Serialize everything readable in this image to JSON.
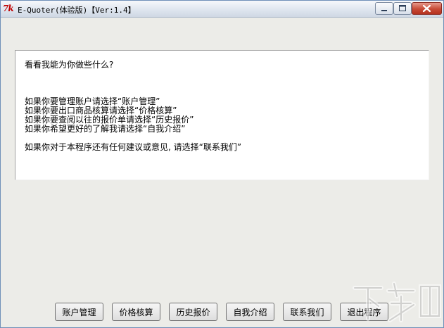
{
  "window": {
    "icon_text": "7k",
    "title": "E-Quoter(体验版)【Ver:1.4】",
    "controls": {
      "minimize": "minimize-icon",
      "maximize": "maximize-icon",
      "close": "close-icon"
    }
  },
  "main": {
    "greeting": "看看我能为你做些什么?",
    "lines": [
      "如果你要管理账户请选择“账户管理”",
      "如果你要出口商品核算请选择“价格核算”",
      "如果你要查阅以往的报价单请选择“历史报价”",
      "如果你希望更好的了解我请选择“自我介绍”"
    ],
    "feedback_line": "如果你对于本程序还有任何建议或意见, 请选择“联系我们”"
  },
  "buttons": [
    {
      "label": "账户管理"
    },
    {
      "label": "价格核算"
    },
    {
      "label": "历史报价"
    },
    {
      "label": "自我介绍"
    },
    {
      "label": "联系我们"
    },
    {
      "label": "退出程序"
    }
  ],
  "watermark": {
    "text": "下载吧"
  },
  "colors": {
    "title_bar": "#dfe6ef",
    "close_button": "#c74a36",
    "window_bg": "#ecece8",
    "panel_bg": "#ffffff",
    "icon_red": "#c00000"
  }
}
